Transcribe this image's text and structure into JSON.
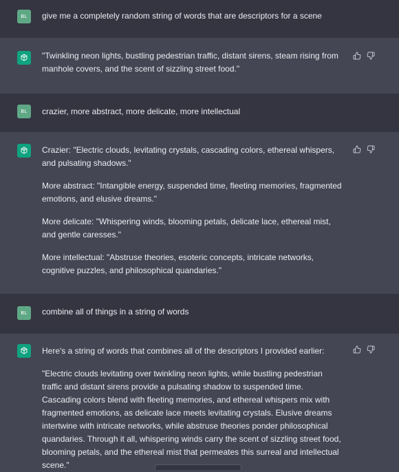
{
  "user": {
    "initials": "BL"
  },
  "messages": [
    {
      "role": "user",
      "text": "give me a completely random string of words that are descriptors for a scene"
    },
    {
      "role": "assistant",
      "paragraphs": [
        "\"Twinkling neon lights, bustling pedestrian traffic, distant sirens, steam rising from manhole covers, and the scent of sizzling street food.\""
      ]
    },
    {
      "role": "user",
      "text": "crazier, more abstract, more delicate, more intellectual"
    },
    {
      "role": "assistant",
      "paragraphs": [
        "Crazier: \"Electric clouds, levitating crystals, cascading colors, ethereal whispers, and pulsating shadows.\"",
        "More abstract: \"Intangible energy, suspended time, fleeting memories, fragmented emotions, and elusive dreams.\"",
        "More delicate: \"Whispering winds, blooming petals, delicate lace, ethereal mist, and gentle caresses.\"",
        "More intellectual: \"Abstruse theories, esoteric concepts, intricate networks, cognitive puzzles, and philosophical quandaries.\""
      ]
    },
    {
      "role": "user",
      "text": "combine all of things in a string of words"
    },
    {
      "role": "assistant",
      "paragraphs": [
        "Here's a string of words that combines all of the descriptors I provided earlier:",
        "\"Electric clouds levitating over twinkling neon lights, while bustling pedestrian traffic and distant sirens provide a pulsating shadow to suspended time. Cascading colors blend with fleeting memories, and ethereal whispers mix with fragmented emotions, as delicate lace meets levitating crystals. Elusive dreams intertwine with intricate networks, while abstruse theories ponder philosophical quandaries. Through it all, whispering winds carry the scent of sizzling street food, blooming petals, and the ethereal mist that permeates this surreal and intellectual scene.\""
      ]
    }
  ],
  "icons": {
    "like": "thumbs-up-icon",
    "dislike": "thumbs-down-icon",
    "assistant_avatar": "openai-logo-icon"
  },
  "colors": {
    "user_bg": "#343541",
    "assistant_bg": "#444654",
    "user_avatar": "#5fa886",
    "assistant_avatar": "#10a37f",
    "text": "#ececf1"
  }
}
